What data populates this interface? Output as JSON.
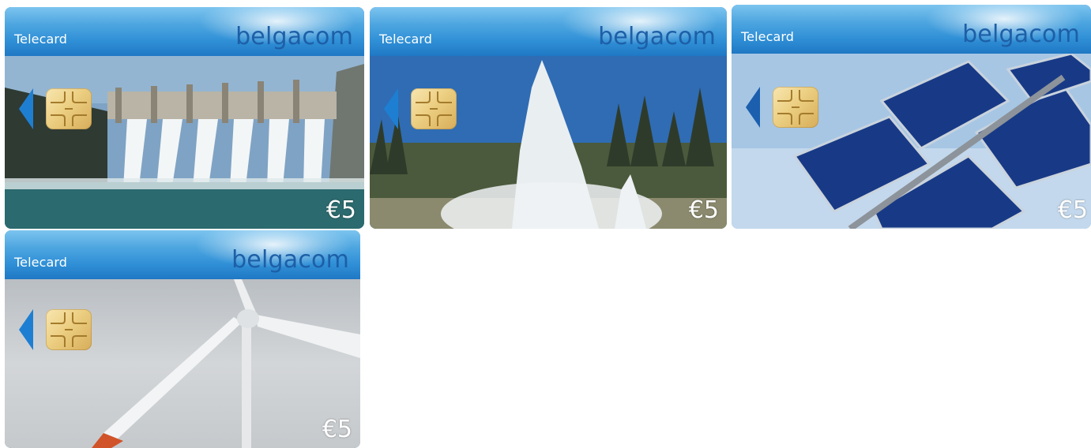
{
  "cards": [
    {
      "label": "Telecard",
      "brand": "belgacom",
      "value": "€5",
      "image": "hydroelectric-dam",
      "colors": {
        "sky": "#5b8fbf",
        "water": "#2a6b72",
        "spray": "#e8eef2"
      }
    },
    {
      "label": "Telecard",
      "brand": "belgacom",
      "value": "€5",
      "image": "geyser",
      "colors": {
        "sky": "#3466a8",
        "forest": "#4a5a3a",
        "steam": "#e6ebee"
      }
    },
    {
      "label": "Telecard",
      "brand": "belgacom",
      "value": "€5",
      "image": "solar-panels",
      "colors": {
        "sky": "#a9c9e6",
        "panel": "#1a3d8a"
      }
    },
    {
      "label": "Telecard",
      "brand": "belgacom",
      "value": "€5",
      "image": "wind-turbine",
      "colors": {
        "sky": "#c9cdd0",
        "blade": "#f2f3f4",
        "tip": "#d0532a"
      }
    }
  ]
}
